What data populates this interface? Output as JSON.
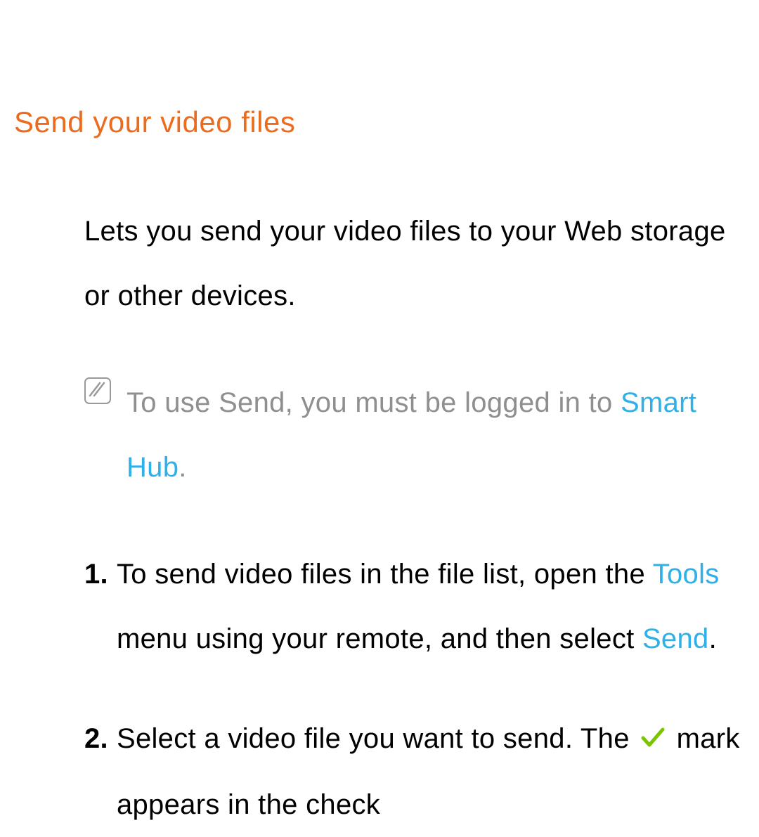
{
  "heading": "Send your video files",
  "intro": "Lets you send your video files to your Web storage or other devices.",
  "note": {
    "prefix": "To use Send, you must be logged in to ",
    "highlight": "Smart Hub",
    "suffix": "."
  },
  "steps": [
    {
      "number": "1.",
      "parts": [
        {
          "text": "To send video files in the file list, open the ",
          "highlight": false
        },
        {
          "text": "Tools",
          "highlight": true
        },
        {
          "text": " menu using your remote, and then select ",
          "highlight": false
        },
        {
          "text": "Send",
          "highlight": true
        },
        {
          "text": ".",
          "highlight": false
        }
      ]
    },
    {
      "number": "2.",
      "parts": [
        {
          "text": "Select a video file you want to send. The ",
          "highlight": false
        },
        {
          "text": "[checkmark]",
          "highlight": false,
          "icon": "checkmark"
        },
        {
          "text": " mark appears in the check",
          "highlight": false
        }
      ]
    }
  ]
}
